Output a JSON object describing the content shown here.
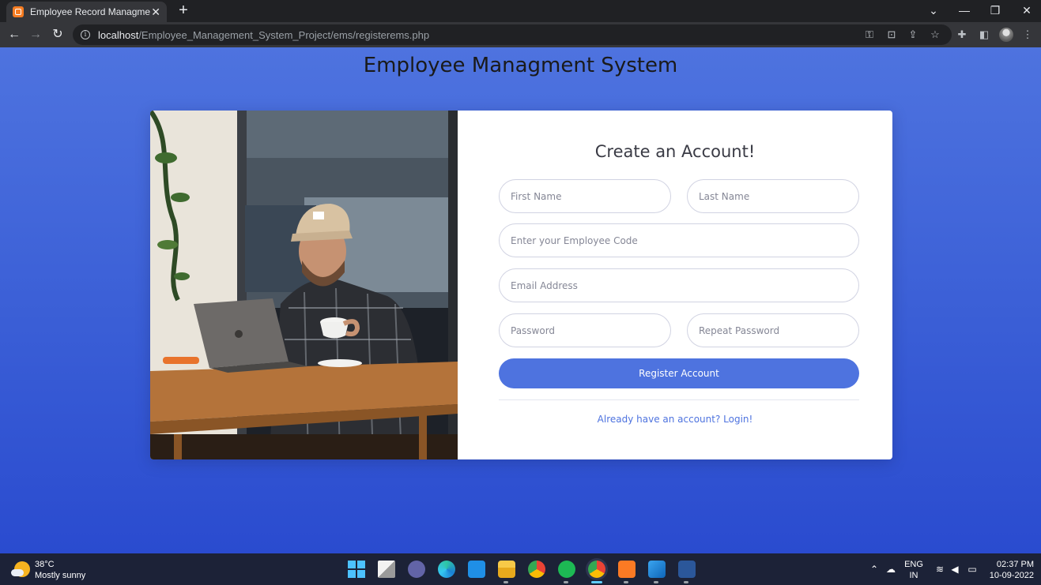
{
  "browser": {
    "tab_title": "Employee Record Managment Sy",
    "url_host": "localhost",
    "url_path": "/Employee_Management_System_Project/ems/registerems.php"
  },
  "page": {
    "heading": "Employee Managment System"
  },
  "form": {
    "title": "Create an Account!",
    "first_name_placeholder": "First Name",
    "last_name_placeholder": "Last Name",
    "employee_code_placeholder": "Enter your Employee Code",
    "email_placeholder": "Email Address",
    "password_placeholder": "Password",
    "repeat_password_placeholder": "Repeat Password",
    "register_label": "Register Account",
    "login_link": "Already have an account? Login!"
  },
  "taskbar": {
    "temperature": "38°C",
    "weather": "Mostly sunny",
    "language_top": "ENG",
    "language_bottom": "IN",
    "time": "02:37 PM",
    "date": "10-09-2022"
  },
  "colors": {
    "accent": "#4e73df",
    "background_top": "#4e73df",
    "background_bottom": "#2a4bcf"
  }
}
